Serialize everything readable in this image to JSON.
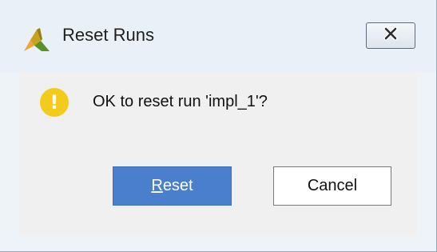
{
  "dialog": {
    "title": "Reset Runs",
    "message": "OK to reset run 'impl_1'?",
    "warning_glyph": "!",
    "icons": {
      "app": "vivado-logo-icon",
      "close": "close-icon",
      "warning": "warning-icon"
    }
  },
  "buttons": {
    "reset": {
      "mnemonic": "R",
      "rest": "eset",
      "label": "Reset"
    },
    "cancel": {
      "label": "Cancel"
    }
  },
  "colors": {
    "primary_button": "#4a7fce",
    "warning": "#f3cc1b"
  }
}
